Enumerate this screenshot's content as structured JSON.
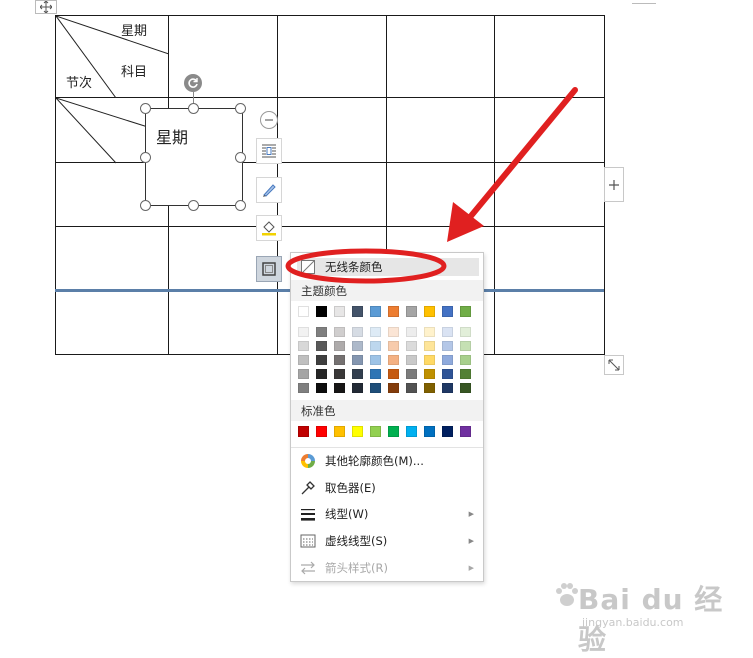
{
  "table": {
    "header_diag": {
      "top_right": "星期",
      "middle": "科目",
      "bottom_left": "节次"
    }
  },
  "textbox": {
    "text": "星期"
  },
  "tools": {
    "collapse_icon": "minus-circle-icon",
    "layout_icon": "text-wrap-icon",
    "pen_icon": "pen-icon",
    "fill_icon": "paint-bucket-icon",
    "outline_icon": "shape-outline-icon",
    "table_add_icon": "plus-icon",
    "resize_icon": "resize-icon",
    "move_icon": "move-icon",
    "rotate_icon": "rotate-icon"
  },
  "menu": {
    "no_line_color": "无线条颜色",
    "theme_colors_label": "主题颜色",
    "standard_colors_label": "标准色",
    "more_outline_colors": "其他轮廓颜色(M)...",
    "eyedropper": "取色器(E)",
    "line_style": "线型(W)",
    "dash_style": "虚线线型(S)",
    "arrow_style": "箭头样式(R)"
  },
  "theme_colors": [
    "#ffffff",
    "#000000",
    "#e7e6e6",
    "#44546a",
    "#5b9bd5",
    "#ed7d31",
    "#a5a5a5",
    "#ffc000",
    "#4472c4",
    "#70ad47"
  ],
  "theme_shades": [
    [
      "#f2f2f2",
      "#d8d8d8",
      "#bfbfbf",
      "#a5a5a5",
      "#7f7f7f"
    ],
    [
      "#7f7f7f",
      "#595959",
      "#3f3f3f",
      "#262626",
      "#0d0d0d"
    ],
    [
      "#d0cece",
      "#aeabab",
      "#757171",
      "#3a3838",
      "#171616"
    ],
    [
      "#d6dce4",
      "#adb9ca",
      "#8496b0",
      "#323f4f",
      "#222a35"
    ],
    [
      "#deebf6",
      "#bdd7ee",
      "#9dc3e6",
      "#2e75b5",
      "#1e4e79"
    ],
    [
      "#fbe5d5",
      "#f7cbac",
      "#f4b183",
      "#c55a11",
      "#833c0b"
    ],
    [
      "#ededed",
      "#dbdbdb",
      "#c9c9c9",
      "#7b7b7b",
      "#525252"
    ],
    [
      "#fff2cc",
      "#fee599",
      "#ffd965",
      "#bf9000",
      "#7f6000"
    ],
    [
      "#dae3f3",
      "#b4c7e7",
      "#8faadc",
      "#2f5496",
      "#1f3864"
    ],
    [
      "#e2efd9",
      "#c5e0b3",
      "#a8d08d",
      "#538135",
      "#375623"
    ]
  ],
  "standard_colors": [
    "#c00000",
    "#ff0000",
    "#ffc000",
    "#ffff00",
    "#92d050",
    "#00b050",
    "#00b0f0",
    "#0070c0",
    "#002060",
    "#7030a0"
  ],
  "annotation": {
    "arrow_color": "#e02020",
    "ellipse_color": "#e02020"
  },
  "watermark": {
    "brand": "Bai du 经验",
    "url": "jingyan.baidu.com"
  }
}
